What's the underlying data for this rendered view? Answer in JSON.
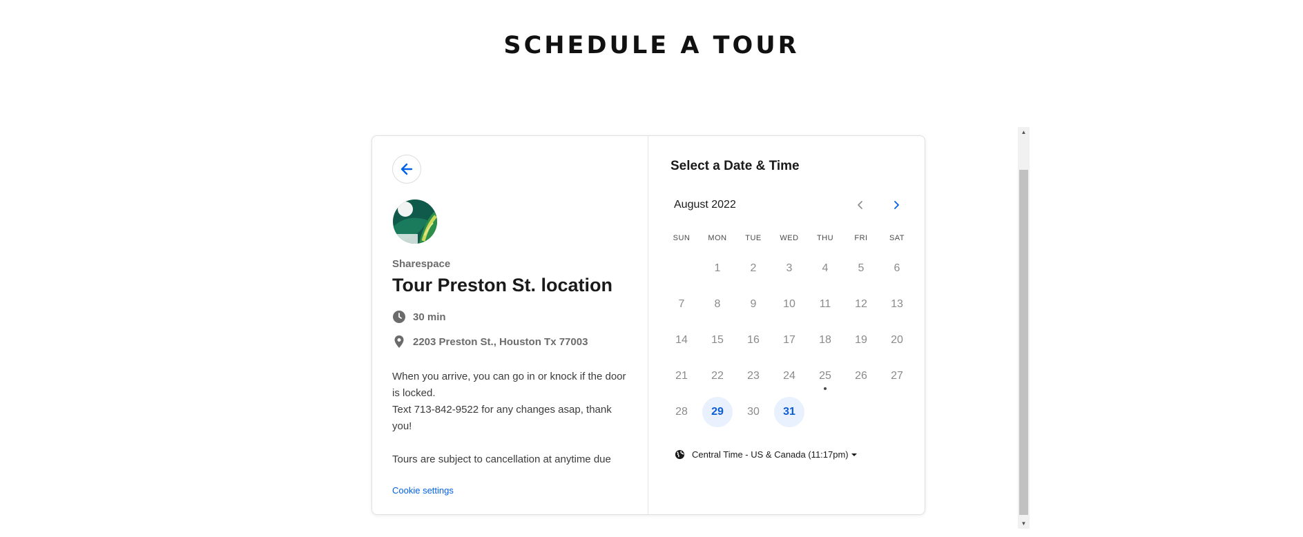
{
  "page": {
    "title": "SCHEDULE A TOUR"
  },
  "event": {
    "host": "Sharespace",
    "title": "Tour Preston St. location",
    "duration": "30 min",
    "location": "2203 Preston St., Houston Tx 77003",
    "description": [
      "When you arrive, you can go in or knock if the door is locked.",
      "Text 713-842-9522 for any changes asap, thank you!",
      "",
      "Tours are subject to cancellation at anytime due"
    ],
    "cookie_settings": "Cookie settings"
  },
  "calendar": {
    "heading": "Select a Date & Time",
    "month": "August 2022",
    "weekdays": [
      "SUN",
      "MON",
      "TUE",
      "WED",
      "THU",
      "FRI",
      "SAT"
    ],
    "weeks": [
      [
        "",
        "1",
        "2",
        "3",
        "4",
        "5",
        "6"
      ],
      [
        "7",
        "8",
        "9",
        "10",
        "11",
        "12",
        "13"
      ],
      [
        "14",
        "15",
        "16",
        "17",
        "18",
        "19",
        "20"
      ],
      [
        "21",
        "22",
        "23",
        "24",
        "25",
        "26",
        "27"
      ],
      [
        "28",
        "29",
        "30",
        "31",
        "",
        "",
        ""
      ]
    ],
    "available_days": [
      "29",
      "31"
    ],
    "today": "25",
    "timezone": "Central Time - US & Canada (11:17pm)"
  },
  "icons": {
    "back": "arrow-left-icon",
    "duration": "clock-icon",
    "location": "map-pin-icon",
    "prev_month": "chevron-left-icon",
    "next_month": "chevron-right-icon",
    "timezone": "globe-icon"
  },
  "colors": {
    "accent": "#0060e6",
    "available_bg": "#e8f1fd",
    "available_text": "#0b5cd6"
  }
}
